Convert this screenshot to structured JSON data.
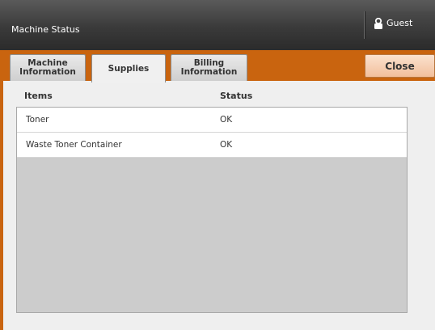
{
  "window": {
    "title": "Machine Status"
  },
  "user": {
    "label": "Guest",
    "icon": "user-lock-icon"
  },
  "tabs": [
    {
      "label_line1": "Machine",
      "label_line2": "Information",
      "active": false
    },
    {
      "label_line1": "Supplies",
      "label_line2": "",
      "active": true
    },
    {
      "label_line1": "Billing",
      "label_line2": "Information",
      "active": false
    }
  ],
  "close_label": "Close",
  "table": {
    "headers": {
      "items": "Items",
      "status": "Status"
    },
    "rows": [
      {
        "item": "Toner",
        "status": "OK"
      },
      {
        "item": "Waste Toner Container",
        "status": "OK"
      }
    ]
  },
  "colors": {
    "accent": "#c9640f",
    "titlebar": "#3a3a3a",
    "close_button": "#f2bf9b"
  }
}
